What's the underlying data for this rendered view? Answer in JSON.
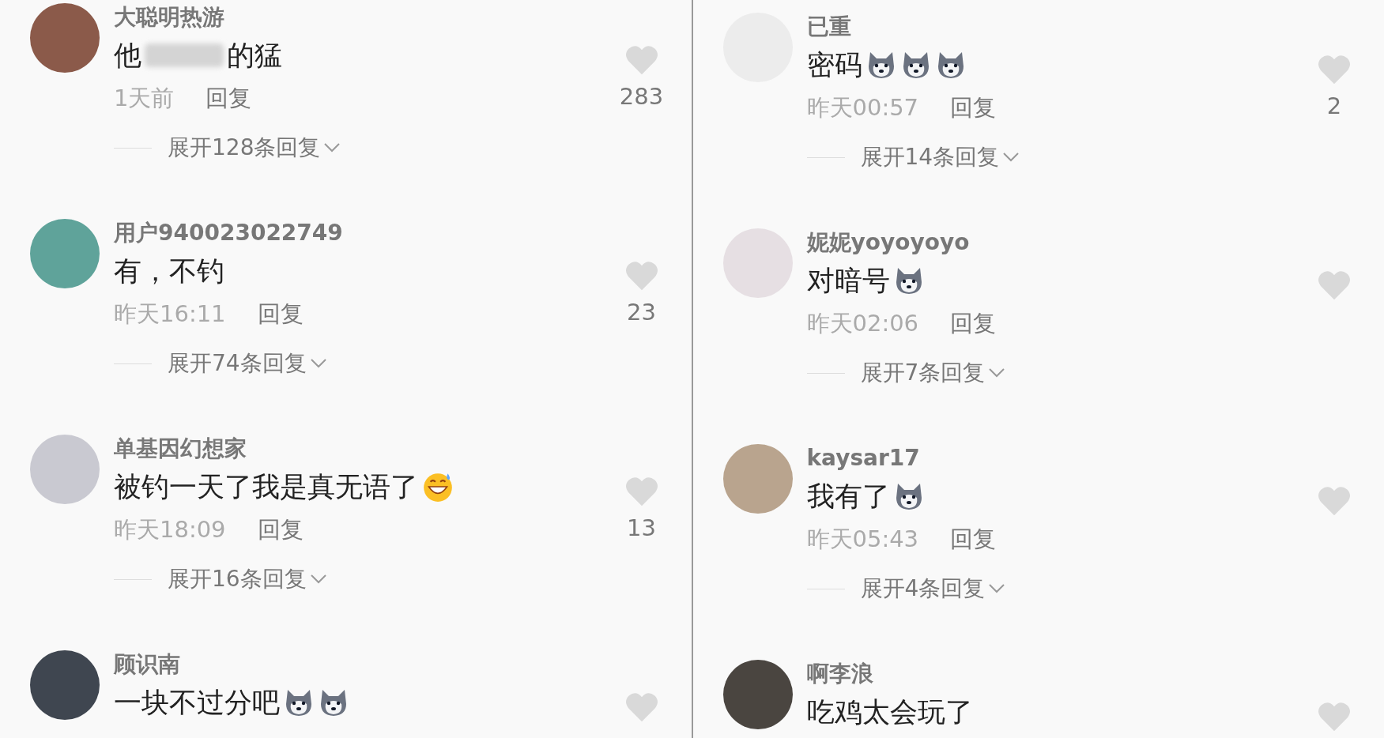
{
  "panels": [
    {
      "comments": [
        {
          "name": "大聪明热游",
          "body": [
            {
              "kind": "text",
              "text": "他"
            },
            {
              "kind": "redacted"
            },
            {
              "kind": "text",
              "text": "的猛"
            }
          ],
          "time": "1天前",
          "reply": "回复",
          "likes": "283",
          "expand": "展开128条回复"
        },
        {
          "name": "用户940023022749",
          "body": [
            {
              "kind": "text",
              "text": "有，不钓"
            }
          ],
          "time": "昨天16:11",
          "reply": "回复",
          "likes": "23",
          "expand": "展开74条回复"
        },
        {
          "name": "单基因幻想家",
          "body": [
            {
              "kind": "text",
              "text": "被钓一天了我是真无语了"
            },
            {
              "kind": "sweat"
            }
          ],
          "time": "昨天18:09",
          "reply": "回复",
          "likes": "13",
          "expand": "展开16条回复"
        },
        {
          "name": "顾识南",
          "body": [
            {
              "kind": "text",
              "text": "一块不过分吧"
            },
            {
              "kind": "dog"
            },
            {
              "kind": "dog"
            }
          ]
        }
      ]
    },
    {
      "comments": [
        {
          "name": "已重",
          "body": [
            {
              "kind": "text",
              "text": "密码"
            },
            {
              "kind": "dog"
            },
            {
              "kind": "dog"
            },
            {
              "kind": "dog"
            }
          ],
          "time": "昨天00:57",
          "reply": "回复",
          "likes": "2",
          "expand": "展开14条回复"
        },
        {
          "name": "妮妮yoyoyoyo",
          "body": [
            {
              "kind": "text",
              "text": "对暗号"
            },
            {
              "kind": "dog"
            }
          ],
          "time": "昨天02:06",
          "reply": "回复",
          "expand": "展开7条回复"
        },
        {
          "name": "kaysar17",
          "body": [
            {
              "kind": "text",
              "text": "我有了"
            },
            {
              "kind": "dog"
            }
          ],
          "time": "昨天05:43",
          "reply": "回复",
          "expand": "展开4条回复"
        },
        {
          "name": "啊李浪",
          "body": [
            {
              "kind": "text",
              "text": "吃鸡太会玩了"
            }
          ]
        }
      ]
    }
  ]
}
